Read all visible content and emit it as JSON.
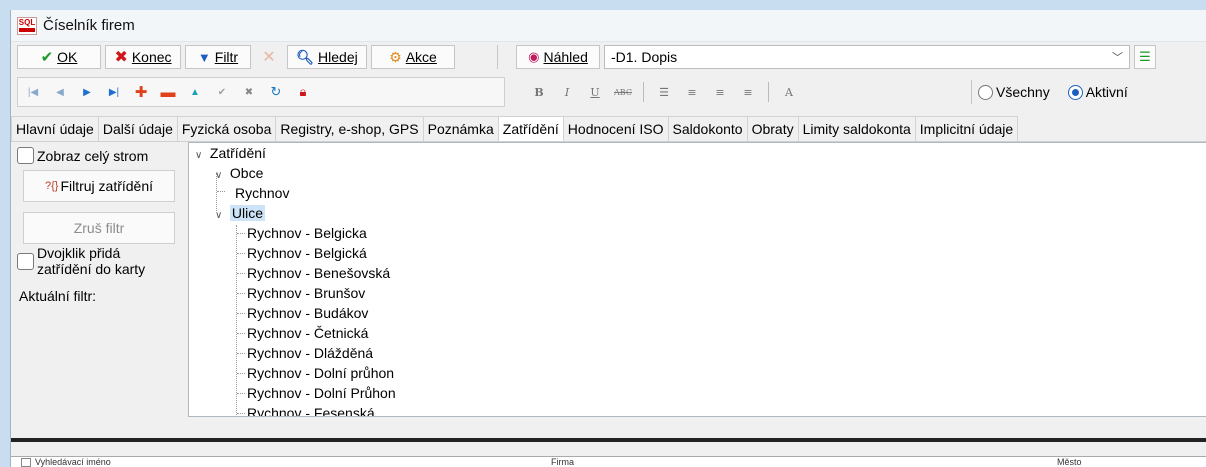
{
  "window": {
    "title": "Číselník firem",
    "app_icon_text": "SQL"
  },
  "toolbar": {
    "ok": "OK",
    "konec": "Konec",
    "filtr": "Filtr",
    "hledej": "Hledej",
    "akce": "Akce",
    "nahled": "Náhled",
    "report_selected": "-D1. Dopis"
  },
  "format_toolbar": {
    "bold": "B",
    "italic": "I",
    "underline": "U",
    "strike": "ABC",
    "font": "A"
  },
  "radios": {
    "vsechny": "Všechny",
    "aktivni": "Aktivní",
    "selected": "Aktivní"
  },
  "tabs": [
    "Hlavní údaje",
    "Další údaje",
    "Fyzická osoba",
    "Registry, e-shop, GPS",
    "Poznámka",
    "Zatřídění",
    "Hodnocení ISO",
    "Saldokonto",
    "Obraty",
    "Limity saldokonta",
    "Implicitní údaje"
  ],
  "active_tab": "Zatřídění",
  "left_panel": {
    "zobraz_cely_strom": "Zobraz celý strom",
    "filtruj_btn": "Filtruj zatřídění",
    "filtruj_icon": "?{}",
    "zrus_filtr_btn": "Zruš filtr",
    "dvojklik_line1": "Dvojklik přidá",
    "dvojklik_line2": "zatřídění do karty",
    "aktualni_filtr": "Aktuální filtr:"
  },
  "tree": {
    "root": "Zatřídění",
    "obce": "Obce",
    "obce_items": [
      "Rychnov"
    ],
    "ulice": "Ulice",
    "ulice_items": [
      "Rychnov - Belgicka",
      "Rychnov - Belgická",
      "Rychnov - Benešovská",
      "Rychnov - Brunšov",
      "Rychnov - Budákov",
      "Rychnov - Četnická",
      "Rychnov - Dlážděná",
      "Rychnov - Dolní průhon",
      "Rychnov - Dolní Průhon",
      "Rychnov - Fesenská"
    ]
  },
  "grid": {
    "col_vyhledavaci": "Vyhledávací iméno",
    "col_firma": "Firma",
    "col_mesto": "Město"
  }
}
